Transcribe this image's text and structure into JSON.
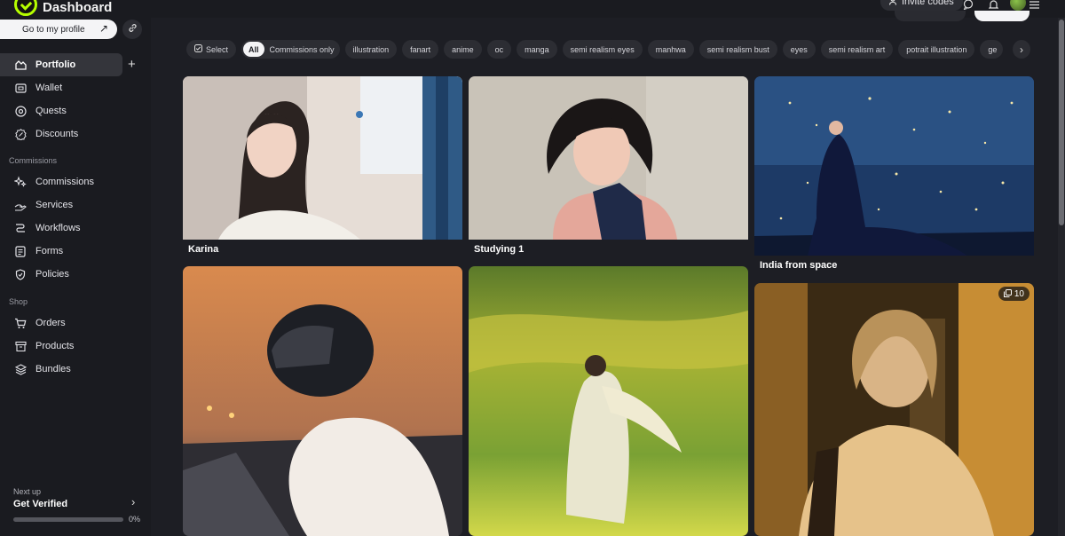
{
  "app": {
    "title": "Dashboard"
  },
  "header": {
    "invite_label": "Invite codes"
  },
  "sidebar": {
    "profile_button": "Go to my profile",
    "items_main": [
      {
        "label": "Portfolio",
        "icon": "portfolio-icon",
        "active": true
      },
      {
        "label": "Wallet",
        "icon": "wallet-icon"
      },
      {
        "label": "Quests",
        "icon": "quests-icon"
      },
      {
        "label": "Discounts",
        "icon": "discounts-icon"
      }
    ],
    "section_commissions": "Commissions",
    "items_commissions": [
      {
        "label": "Commissions",
        "icon": "sparkle-icon"
      },
      {
        "label": "Services",
        "icon": "services-icon"
      },
      {
        "label": "Workflows",
        "icon": "workflows-icon"
      },
      {
        "label": "Forms",
        "icon": "forms-icon"
      },
      {
        "label": "Policies",
        "icon": "shield-icon"
      }
    ],
    "section_shop": "Shop",
    "items_shop": [
      {
        "label": "Orders",
        "icon": "cart-icon"
      },
      {
        "label": "Products",
        "icon": "box-icon"
      },
      {
        "label": "Bundles",
        "icon": "layers-icon"
      }
    ],
    "next_up": {
      "label": "Next up",
      "title": "Get Verified",
      "progress_text": "0%",
      "progress": 0
    }
  },
  "filters": {
    "select_label": "Select",
    "all_label": "All",
    "commissions_only": "Commissions only",
    "tags": [
      "illustration",
      "fanart",
      "anime",
      "oc",
      "manga",
      "semi realism eyes",
      "manhwa",
      "semi realism bust",
      "eyes",
      "semi realism art",
      "potrait illustration"
    ],
    "clipped_tag": "ge"
  },
  "gallery": [
    {
      "title": "Karina"
    },
    {
      "title": "Studying 1"
    },
    {
      "title": "India from space"
    },
    {
      "title": ""
    },
    {
      "title": ""
    },
    {
      "title": "",
      "count": "10"
    }
  ],
  "colors": {
    "accent": "#b6ff00",
    "background": "#1d1e24",
    "sidebar": "#1a1b20",
    "chip": "#2c2d33"
  }
}
